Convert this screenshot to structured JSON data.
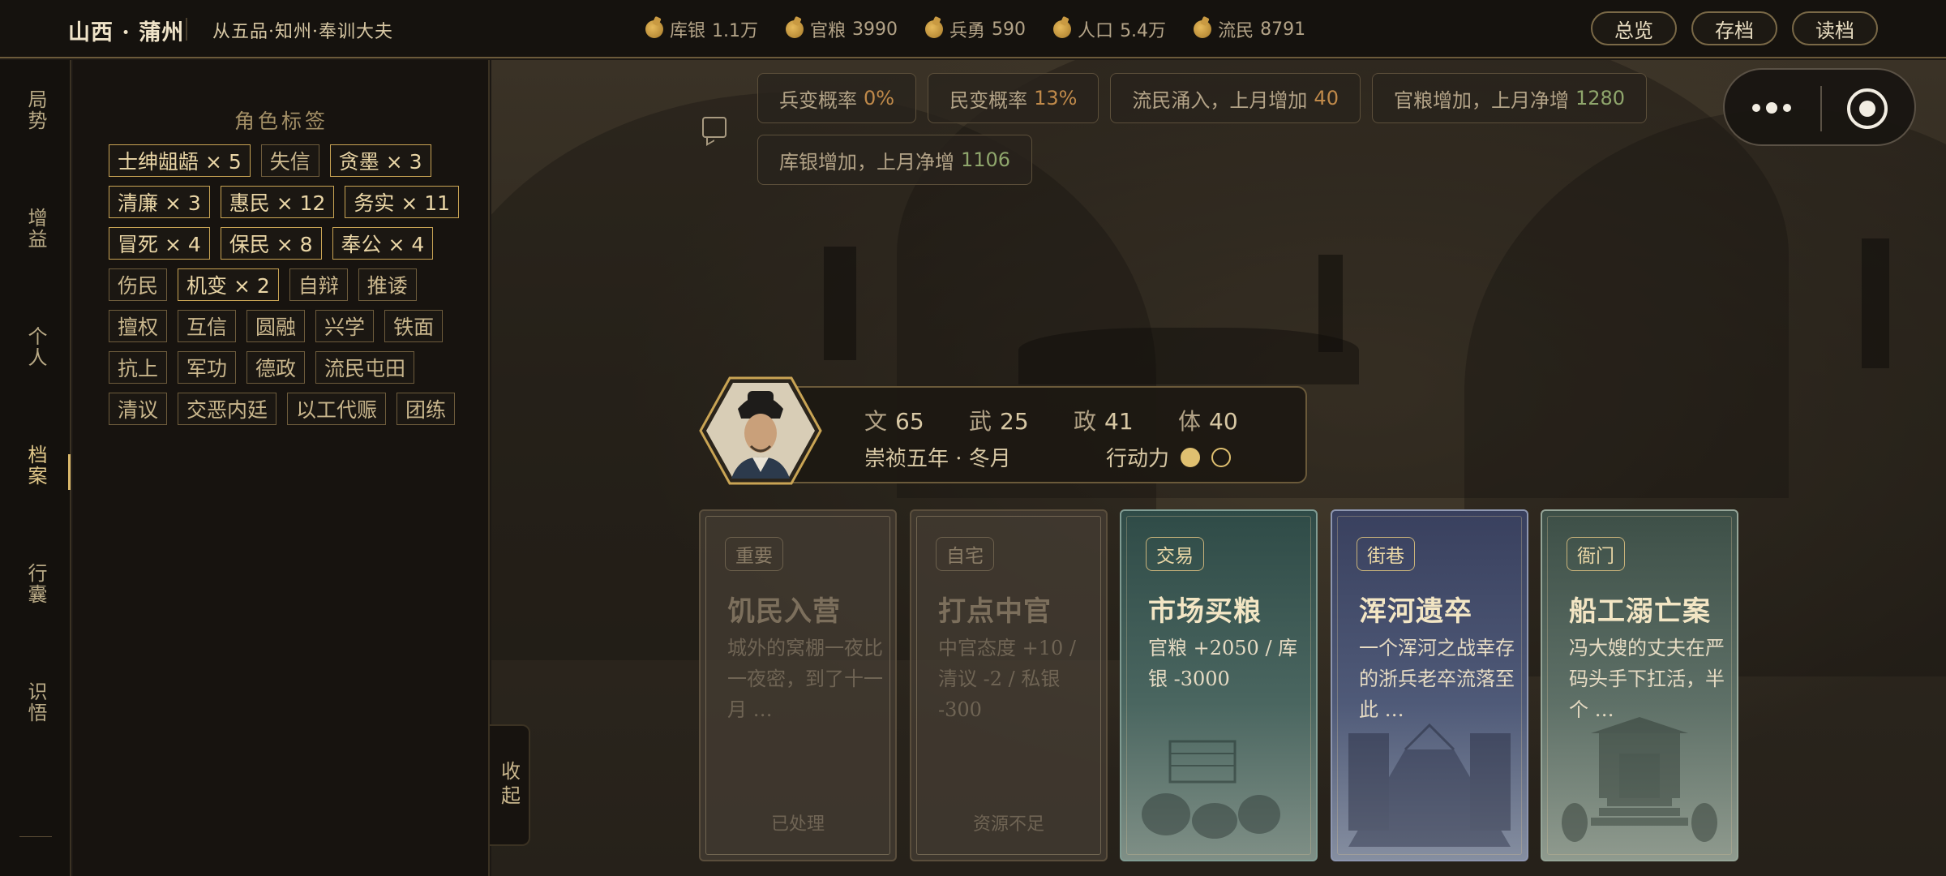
{
  "header": {
    "location": "山西 · 蒲州",
    "rank": "从五品·知州·奉训大夫",
    "resources": [
      {
        "icon": "money-bag-icon",
        "label": "库银",
        "value": "1.1万"
      },
      {
        "icon": "grain-sack-icon",
        "label": "官粮",
        "value": "3990"
      },
      {
        "icon": "soldier-icon",
        "label": "兵勇",
        "value": "590"
      },
      {
        "icon": "population-icon",
        "label": "人口",
        "value": "5.4万"
      },
      {
        "icon": "refugee-icon",
        "label": "流民",
        "value": "8791"
      }
    ],
    "buttons": {
      "overview": "总览",
      "save": "存档",
      "load": "读档"
    }
  },
  "rail": {
    "items": [
      "局势",
      "增益",
      "个人",
      "档案",
      "行囊",
      "识悟"
    ],
    "active": "档案"
  },
  "tag_panel": {
    "title": "角色标签",
    "tags": [
      {
        "label": "士绅龃龉 × 5",
        "strong": true
      },
      {
        "label": "失信",
        "strong": false
      },
      {
        "label": "贪墨 × 3",
        "strong": true
      },
      {
        "label": "清廉 × 3",
        "strong": true
      },
      {
        "label": "惠民 × 12",
        "strong": true
      },
      {
        "label": "务实 × 11",
        "strong": true
      },
      {
        "label": "冒死 × 4",
        "strong": true
      },
      {
        "label": "保民 × 8",
        "strong": true
      },
      {
        "label": "奉公 × 4",
        "strong": true
      },
      {
        "label": "伤民",
        "strong": false
      },
      {
        "label": "机变 × 2",
        "strong": true
      },
      {
        "label": "自辩",
        "strong": false
      },
      {
        "label": "推诿",
        "strong": false
      },
      {
        "label": "擅权",
        "strong": false
      },
      {
        "label": "互信",
        "strong": false
      },
      {
        "label": "圆融",
        "strong": false
      },
      {
        "label": "兴学",
        "strong": false
      },
      {
        "label": "铁面",
        "strong": false
      },
      {
        "label": "抗上",
        "strong": false
      },
      {
        "label": "军功",
        "strong": false
      },
      {
        "label": "德政",
        "strong": false
      },
      {
        "label": "流民屯田",
        "strong": false
      },
      {
        "label": "清议",
        "strong": false
      },
      {
        "label": "交恶内廷",
        "strong": false
      },
      {
        "label": "以工代赈",
        "strong": false
      },
      {
        "label": "团练",
        "strong": false
      }
    ],
    "collapse_label": "收起"
  },
  "notices": [
    {
      "text": "兵变概率",
      "value": "0%",
      "tone": "bad"
    },
    {
      "text": "民变概率",
      "value": "13%",
      "tone": "bad"
    },
    {
      "text": "流民涌入，上月增加",
      "value": "40",
      "tone": "bad"
    },
    {
      "text": "官粮增加，上月净增",
      "value": "1280",
      "tone": "good"
    },
    {
      "text": "库银增加，上月净增",
      "value": "1106",
      "tone": "good"
    }
  ],
  "character": {
    "stats": [
      {
        "key": "文",
        "value": "65"
      },
      {
        "key": "武",
        "value": "25"
      },
      {
        "key": "政",
        "value": "41"
      },
      {
        "key": "体",
        "value": "40"
      }
    ],
    "date": "崇祯五年 · 冬月",
    "action_label": "行动力",
    "action_points": {
      "current": 1,
      "max": 2
    }
  },
  "cards": [
    {
      "tag": "重要",
      "title": "饥民入营",
      "desc": "城外的窝棚一夜比一夜密，到了十一月 …",
      "footer": "已处理",
      "style": "dim"
    },
    {
      "tag": "自宅",
      "title": "打点中官",
      "desc": "中官态度 +10 / 清议 -2 / 私银 -300",
      "footer": "资源不足",
      "style": "dim"
    },
    {
      "tag": "交易",
      "title": "市场买粮",
      "desc": "官粮 +2050 / 库银 -3000",
      "footer": "",
      "style": "teal"
    },
    {
      "tag": "街巷",
      "title": "浑河遗卒",
      "desc": "一个浑河之战幸存的浙兵老卒流落至此 …",
      "footer": "",
      "style": "blue"
    },
    {
      "tag": "衙门",
      "title": "船工溺亡案",
      "desc": "冯大嫂的丈夫在严码头手下扛活，半个 …",
      "footer": "",
      "style": "sage"
    }
  ],
  "colors": {
    "accent": "#d9b76a",
    "good": "#8fa66c",
    "bad": "#c08a4a"
  }
}
